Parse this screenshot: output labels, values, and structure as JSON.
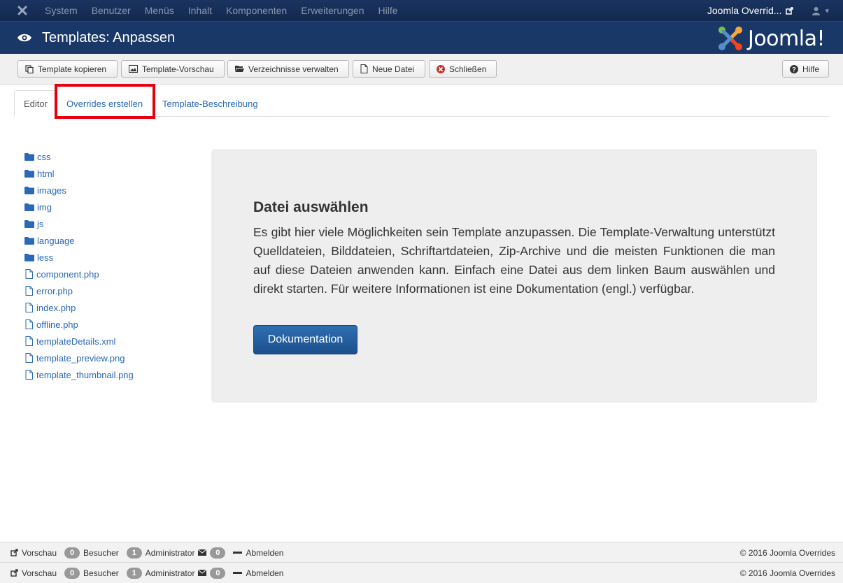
{
  "navbar": {
    "menu": [
      "System",
      "Benutzer",
      "Menüs",
      "Inhalt",
      "Komponenten",
      "Erweiterungen",
      "Hilfe"
    ],
    "site_name": "Joomla Overrid...",
    "user_icon": "user-icon"
  },
  "header": {
    "title": "Templates: Anpassen",
    "brand": "Joomla!"
  },
  "toolbar": {
    "buttons": [
      {
        "label": "Template kopieren",
        "icon": "copy-icon"
      },
      {
        "label": "Template-Vorschau",
        "icon": "image-icon"
      },
      {
        "label": "Verzeichnisse verwalten",
        "icon": "folder-open-icon"
      },
      {
        "label": "Neue Datei",
        "icon": "file-icon"
      },
      {
        "label": "Schließen",
        "icon": "cancel-circle-icon"
      }
    ],
    "help_label": "Hilfe"
  },
  "tabs": [
    "Editor",
    "Overrides erstellen",
    "Template-Beschreibung"
  ],
  "tree": [
    {
      "label": "css",
      "type": "folder"
    },
    {
      "label": "html",
      "type": "folder"
    },
    {
      "label": "images",
      "type": "folder"
    },
    {
      "label": "img",
      "type": "folder"
    },
    {
      "label": "js",
      "type": "folder"
    },
    {
      "label": "language",
      "type": "folder"
    },
    {
      "label": "less",
      "type": "folder"
    },
    {
      "label": "component.php",
      "type": "file"
    },
    {
      "label": "error.php",
      "type": "file"
    },
    {
      "label": "index.php",
      "type": "file"
    },
    {
      "label": "offline.php",
      "type": "file"
    },
    {
      "label": "templateDetails.xml",
      "type": "file"
    },
    {
      "label": "template_preview.png",
      "type": "file"
    },
    {
      "label": "template_thumbnail.png",
      "type": "file"
    }
  ],
  "panel": {
    "heading": "Datei auswählen",
    "text": "Es gibt hier viele Möglichkeiten sein Template anzupassen. Die Template-Verwaltung unterstützt Quelldateien, Bilddateien, Schriftartdateien, Zip-Archive und die meisten Funktionen die man auf diese Dateien anwenden kann. Einfach eine Datei aus dem linken Baum auswählen und direkt starten. Für weitere Informationen ist eine Dokumentation (engl.) verfügbar.",
    "button": "Dokumentation"
  },
  "status": {
    "preview": "Vorschau",
    "visitors_count": "0",
    "visitors_label": "Besucher",
    "admins_count": "1",
    "admins_label": "Administrator",
    "messages_count": "0",
    "logout": "Abmelden",
    "copyright": "© 2016 Joomla Overrides"
  }
}
